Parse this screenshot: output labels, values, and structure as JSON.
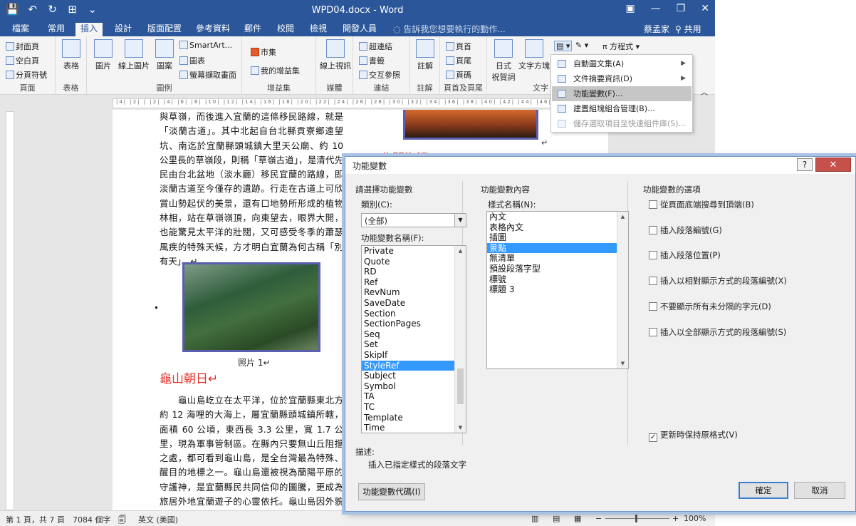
{
  "titlebar": {
    "quick_access": [
      "💾",
      "↶",
      "↻",
      "⊞",
      "⌄"
    ],
    "title": "WPD04.docx - Word",
    "controls": [
      "▣",
      "—",
      "❐",
      "✕"
    ]
  },
  "tabs": [
    "檔案",
    "常用",
    "插入",
    "設計",
    "版面配置",
    "參考資料",
    "郵件",
    "校閱",
    "檢視",
    "開發人員"
  ],
  "tell_me": "告訴我您想要執行的動作...",
  "user": "蔡孟家",
  "share": "共用",
  "ribbon": {
    "pages": {
      "label": "頁面",
      "items": [
        "封面頁",
        "空白頁",
        "分頁符號"
      ]
    },
    "tables": {
      "label": "表格",
      "button": "表格"
    },
    "illustrations": {
      "label": "圖例",
      "picture": "圖片",
      "online_picture": "線上圖片",
      "shapes": "圖案",
      "smartart": "SmartArt...",
      "chart": "圖表",
      "screenshot": "螢幕擷取畫面"
    },
    "addins": {
      "label": "增益集",
      "store": "市集",
      "my_addins": "我的增益集"
    },
    "media": {
      "label": "媒體",
      "online_video": "線上視訊"
    },
    "links": {
      "label": "連結",
      "hyperlink": "超連結",
      "bookmark": "書籤",
      "cross_ref": "交互參照"
    },
    "comments": {
      "label": "註解",
      "comment": "註解"
    },
    "header_footer": {
      "label": "頁首及頁尾",
      "header": "頁首",
      "footer": "頁尾",
      "page_number": "頁碼"
    },
    "text": {
      "label": "文字",
      "japanese": "日式",
      "japanese2": "祝賀詞",
      "textbox": "文字方塊"
    },
    "equation": "方程式"
  },
  "quick_parts_menu": [
    {
      "label": "自動圖文集(A)",
      "arrow": "▶"
    },
    {
      "label": "文件摘要資訊(D)",
      "arrow": "▶"
    },
    {
      "label": "功能變數(F)..."
    },
    {
      "label": "建置組塊組合管理(B)..."
    },
    {
      "label": "儲存選取項目至快速組件庫(S)..."
    }
  ],
  "ruler_text": "|4| |2| |  |2| |4| |6| |8| |10| |12| |14| |16| |18| |20| |22| |24| |26| |28| |30| |32| |34| |36| |38| |40| |42| |44| |46|",
  "document": {
    "col1_top": "與草嶺，而後進入宜蘭的這條移民路線，就是「淡蘭古道」。其中北起自台北縣貢寮鄉遠望坑、南迄於宜蘭縣頭城鎮大里天公廟、約 10 公里長的草嶺段，則稱「草嶺古道」，是清代先民由台北盆地（淡水廳）移民宜蘭的路線，即淡蘭古道至今僅存的遺跡。行走在古道上可欣賞山勢起伏的美景，還有口地勢所形成的植物林相，站在草嶺嶺頂，向東望去，眼界大開，也能驚見太平洋的壯闊，又可感受冬季的蕭瑟風疾的特殊天候，方才明白宜蘭為何古稱「別有天」。↵",
    "caption": "照片 1↵",
    "heading1": "龜山朝日↵",
    "col1_bottom": "　　龜山島屹立在太平洋，位於宜蘭縣東北方約 12 海哩的大海上，屬宜蘭縣頭城鎮所轄，面積 60 公頃，東西長 3.3 公里，寬 1.7 公里，現為軍事管制區。在縣內只要無山丘阻擋之處，都可看到龜山島，是全台灣最為特殊、醒目的地標之一。龜山島還被視為蘭陽平原的守護神，是宜蘭縣民共同信仰的圖騰，更成為旅居外地宜蘭遊子的心靈依托。龜山島因外貌酷似浮龜而得名，主要由兩座火山體組成龜",
    "heading2": "北關海濤",
    "photo_mark": "↵"
  },
  "statusbar": {
    "page": "第 1 頁，共 7 頁",
    "words": "7084 個字",
    "proof": "🗐",
    "language": "英文 (美國)",
    "zoom": "100%",
    "zoom_minus": "−",
    "zoom_plus": "+"
  },
  "dialog": {
    "title": "功能變數",
    "help": "?",
    "close": "✕",
    "choose_field": "請選擇功能變數",
    "category_label": "類別(C):",
    "category_value": "(全部)",
    "field_names_label": "功能變數名稱(F):",
    "field_names": [
      "Private",
      "Quote",
      "RD",
      "Ref",
      "RevNum",
      "SaveDate",
      "Section",
      "SectionPages",
      "Seq",
      "Set",
      "SkipIf",
      "StyleRef",
      "Subject",
      "Symbol",
      "TA",
      "TC",
      "Template",
      "Time"
    ],
    "field_properties": "功能變數內容",
    "style_name_label": "樣式名稱(N):",
    "style_names": [
      "內文",
      "表格內文",
      "插圖",
      "景點",
      "無清單",
      "預設段落字型",
      "標號",
      "標題 3"
    ],
    "field_options": "功能變數的選項",
    "options": [
      {
        "label": "從頁面底端搜尋到頂端(B)",
        "checked": false
      },
      {
        "label": "插入段落編號(G)",
        "checked": false
      },
      {
        "label": "插入段落位置(P)",
        "checked": false
      },
      {
        "label": "插入以相對顯示方式的段落編號(X)",
        "checked": false
      },
      {
        "label": "不要顯示所有未分隔的字元(D)",
        "checked": false
      },
      {
        "label": "插入以全部顯示方式的段落編號(S)",
        "checked": false
      }
    ],
    "preserve": {
      "label": "更新時保持原格式(V)",
      "checked": true
    },
    "description_label": "描述:",
    "description": "插入已指定樣式的段落文字",
    "field_codes_button": "功能變數代碼(I)",
    "ok": "確定",
    "cancel": "取消",
    "check_mark": "✓"
  }
}
